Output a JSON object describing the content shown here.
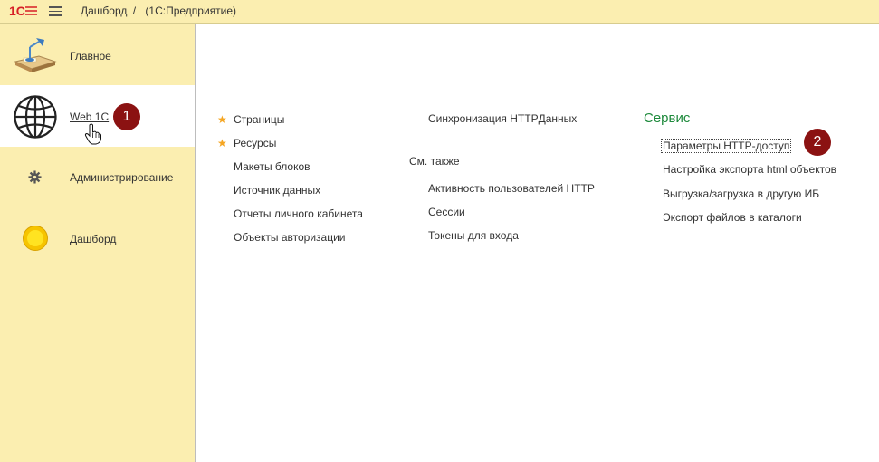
{
  "header": {
    "logo_text": "1С",
    "breadcrumb_page": "Дашборд",
    "breadcrumb_sep": "/",
    "app_name": "(1С:Предприятие)"
  },
  "sidebar": {
    "items": [
      {
        "label": "Главное",
        "icon": "desk-lamp-icon"
      },
      {
        "label": "Web 1C",
        "icon": "globe-icon",
        "active": true
      },
      {
        "label": "Администрирование",
        "icon": "gear-icon"
      },
      {
        "label": "Дашборд",
        "icon": "sun-icon"
      }
    ]
  },
  "main": {
    "col1": [
      {
        "label": "Страницы",
        "starred": true
      },
      {
        "label": "Ресурсы",
        "starred": true
      },
      {
        "label": "Макеты блоков"
      },
      {
        "label": "Источник данных"
      },
      {
        "label": "Отчеты личного кабинета"
      },
      {
        "label": "Объекты авторизации"
      }
    ],
    "col2": {
      "top": "Синхронизация HTTPДанных",
      "see_also": "См. также",
      "items": [
        "Активность пользователей HTTP",
        "Сессии",
        "Токены для входа"
      ]
    },
    "col3": {
      "title": "Сервис",
      "items": [
        "Параметры HTTP-доступ",
        "Настройка экспорта html объектов",
        "Выгрузка/загрузка в другую ИБ",
        "Экспорт файлов в каталоги"
      ]
    }
  },
  "annotations": {
    "badge1": "1",
    "badge2": "2"
  },
  "colors": {
    "panel": "#fbeeb0",
    "section_title": "#1e8a3c",
    "star": "#f5a623",
    "badge": "#8b1212"
  }
}
